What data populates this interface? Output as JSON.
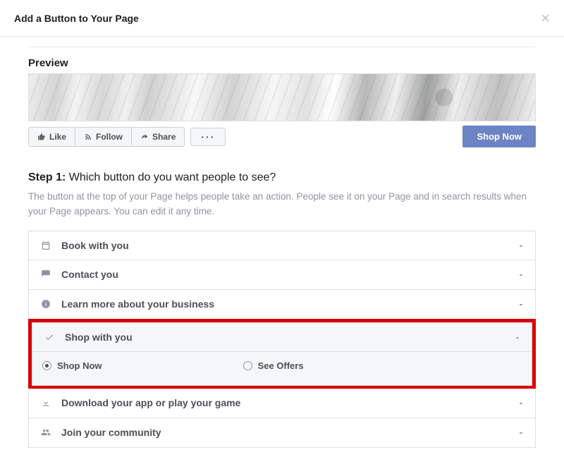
{
  "dialog": {
    "title": "Add a Button to Your Page"
  },
  "preview": {
    "label": "Preview",
    "actions": {
      "like": "Like",
      "follow": "Follow",
      "share": "Share",
      "more": "···"
    },
    "cta_label": "Shop Now"
  },
  "step1": {
    "prefix": "Step 1:",
    "question": " Which button do you want people to see?",
    "description": "The button at the top of your Page helps people take an action. People see it on your Page and in search results when your Page appears. You can edit it any time."
  },
  "options": {
    "book": "Book with you",
    "contact": "Contact you",
    "learn": "Learn more about your business",
    "shop": "Shop with you",
    "download": "Download your app or play your game",
    "join": "Join your community"
  },
  "shop_options": {
    "shop_now": "Shop Now",
    "see_offers": "See Offers"
  }
}
